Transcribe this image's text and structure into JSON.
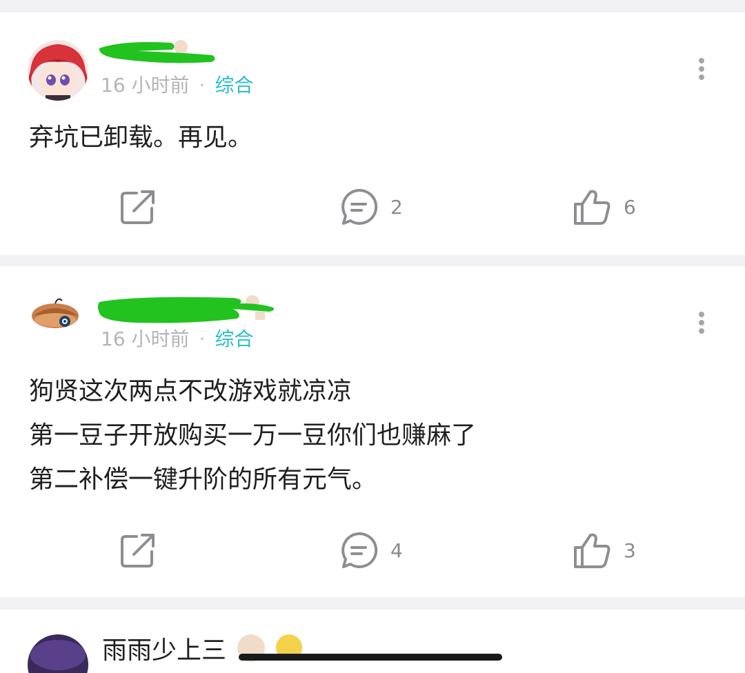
{
  "posts": [
    {
      "time": "16 小时前",
      "separator": "·",
      "tag": "综合",
      "content": [
        "弃坑已卸载。再见。"
      ],
      "comments": "2",
      "likes": "6"
    },
    {
      "time": "16 小时前",
      "separator": "·",
      "tag": "综合",
      "content": [
        "狗贤这次两点不改游戏就凉凉",
        "第一豆子开放购买一万一豆你们也赚麻了",
        "第二补偿一键升阶的所有元气。"
      ],
      "comments": "4",
      "likes": "3"
    },
    {
      "partial_username": "雨雨少上三"
    }
  ],
  "colors": {
    "accent": "#2bbfc6",
    "meta": "#b4b4b8",
    "text": "#1f1f1f",
    "redaction": "#22c21f"
  }
}
